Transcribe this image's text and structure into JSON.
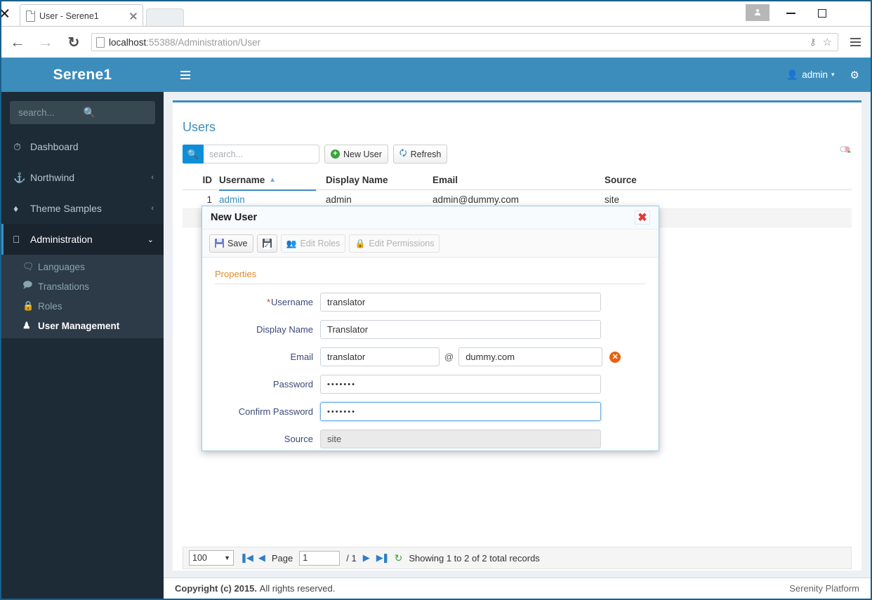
{
  "browser": {
    "tab_title": "User - Serene1",
    "url_prefix": "localhost",
    "url_rest": ":55388/Administration/User",
    "back_icon": "back-arrow-icon",
    "forward_icon": "forward-arrow-icon",
    "reload_icon": "reload-icon",
    "key_icon": "key-icon",
    "star_icon": "star-icon",
    "menu_icon": "hamburger-menu-icon",
    "minimize_label": "—",
    "maximize_label": "□",
    "close_label": "✕"
  },
  "sidebar": {
    "brand": "Serene1",
    "search_placeholder": "search...",
    "search_icon": "magnifier-icon",
    "items": [
      {
        "label": "Dashboard",
        "icon": "◴",
        "icon_name": "dashboard-icon",
        "chevron": ""
      },
      {
        "label": "Northwind",
        "icon": "⚓",
        "icon_name": "anchor-icon",
        "chevron": "‹"
      },
      {
        "label": "Theme Samples",
        "icon": "♦",
        "icon_name": "diamond-icon",
        "chevron": "‹"
      },
      {
        "label": "Administration",
        "icon": "▭",
        "icon_name": "monitor-icon",
        "chevron": "⌄"
      }
    ],
    "subitems": [
      {
        "label": "Languages",
        "icon": "☷",
        "icon_name": "chat-bubbles-icon"
      },
      {
        "label": "Translations",
        "icon": "▤",
        "icon_name": "comment-icon"
      },
      {
        "label": "Roles",
        "icon": "⚿",
        "icon_name": "lock-icon"
      },
      {
        "label": "User Management",
        "icon": "☺",
        "icon_name": "user-icon"
      }
    ]
  },
  "topbar": {
    "menu_icon": "hamburger-icon",
    "user_icon": "user-icon",
    "user_label": "admin",
    "caret": "▾",
    "settings_icon": "⚙"
  },
  "page": {
    "title": "Users",
    "toolbar": {
      "search_placeholder": "search...",
      "search_icon": "magnifier-icon",
      "new_user_label": "New User",
      "new_user_icon": "plus-circle-icon",
      "refresh_label": "Refresh",
      "refresh_icon": "refresh-icon",
      "column_picker_icon": "column-picker-icon"
    },
    "grid": {
      "columns": [
        "ID",
        "Username",
        "Display Name",
        "Email",
        "Source"
      ],
      "sorted_column": "Username",
      "sort_caret": "▲",
      "rows": [
        {
          "id": "1",
          "username": "admin",
          "display_name": "admin",
          "email": "admin@dummy.com",
          "source": "site"
        },
        {
          "id": "",
          "username": "",
          "display_name": "",
          "email": "",
          "source": ""
        }
      ]
    },
    "pager": {
      "page_size": "100",
      "page_size_caret": "▼",
      "first_icon": "first-page-icon",
      "prev_icon": "prev-page-icon",
      "page_label": "Page",
      "page_value": "1",
      "page_total": "/ 1",
      "next_icon": "▶",
      "last_icon": "last-page-icon",
      "refresh_icon": "↻",
      "status": "Showing 1 to 2 of 2 total records"
    }
  },
  "dialog": {
    "title": "New User",
    "close_icon": "✖",
    "toolbar": {
      "save_label": "Save",
      "save_icon": "floppy-save-icon",
      "apply_icon": "floppy-check-icon",
      "edit_roles_label": "Edit Roles",
      "edit_roles_icon": "roles-icon",
      "edit_permissions_label": "Edit Permissions",
      "edit_permissions_icon": "lock-icon"
    },
    "legend": "Properties",
    "fields": {
      "username_label": "Username",
      "username_required": "*",
      "username_value": "translator",
      "display_name_label": "Display Name",
      "display_name_value": "Translator",
      "email_label": "Email",
      "email_local_value": "translator",
      "email_at": "@",
      "email_domain_value": "dummy.com",
      "email_error_icon": "✕",
      "password_label": "Password",
      "password_value": "•••••••",
      "confirm_password_label": "Confirm Password",
      "confirm_password_value": "•••••••",
      "source_label": "Source",
      "source_value": "site"
    }
  },
  "footer": {
    "copyright_bold": "Copyright (c) 2015.",
    "copyright_rest": "All rights reserved.",
    "right": "Serenity Platform"
  }
}
